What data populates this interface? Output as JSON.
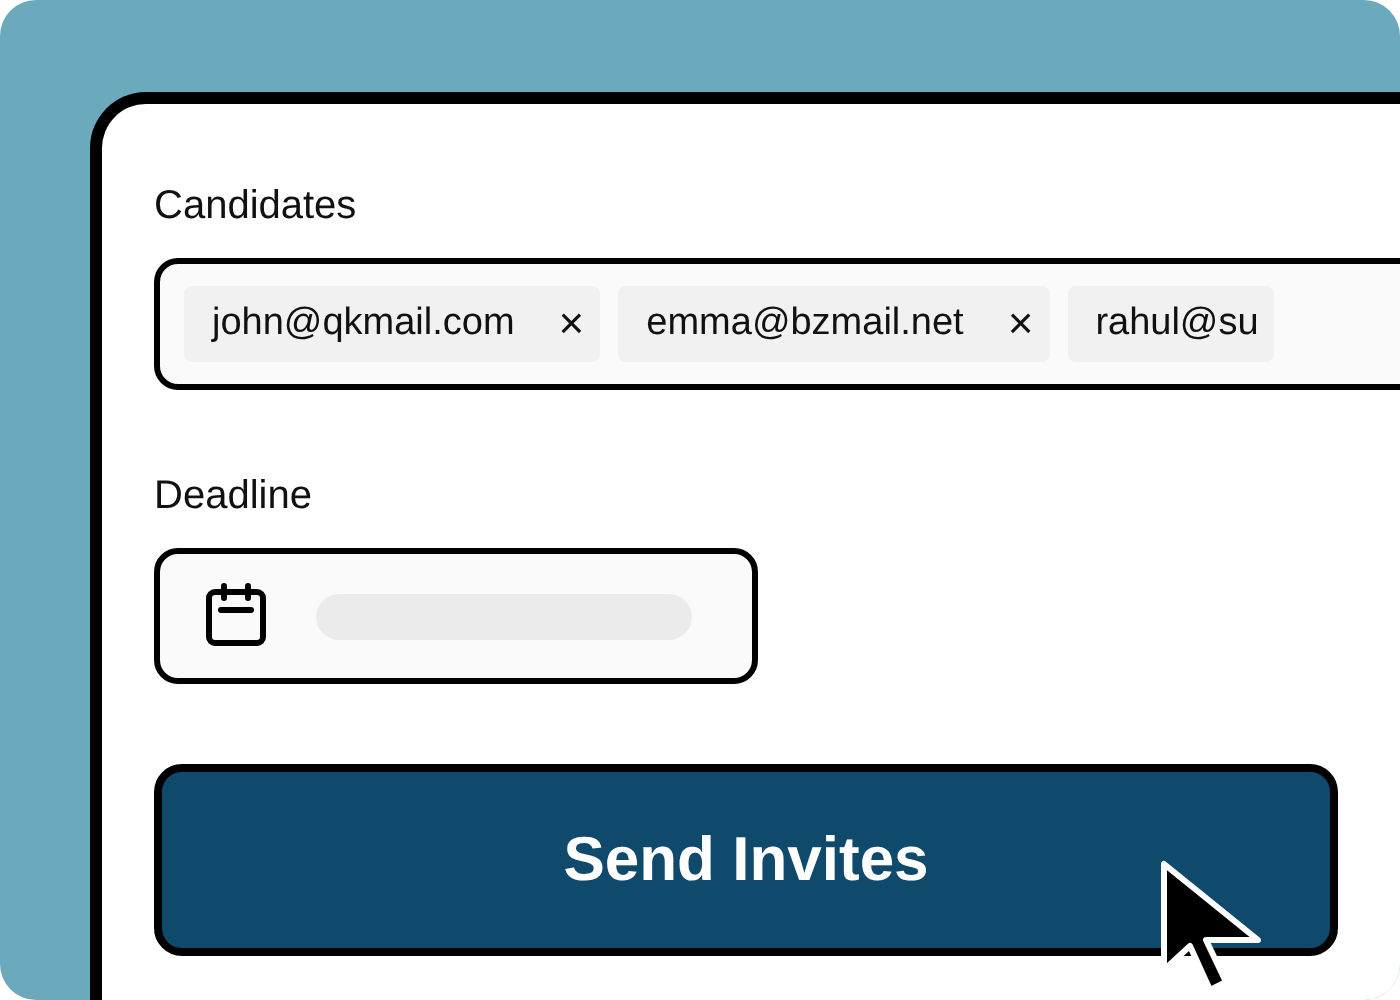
{
  "candidates": {
    "label": "Candidates",
    "chips": [
      {
        "email": "john@qkmail.com",
        "remove": "×"
      },
      {
        "email": "emma@bzmail.net",
        "remove": "×"
      },
      {
        "email": "rahul@su"
      }
    ]
  },
  "deadline": {
    "label": "Deadline"
  },
  "submit": {
    "label": "Send Invites"
  }
}
